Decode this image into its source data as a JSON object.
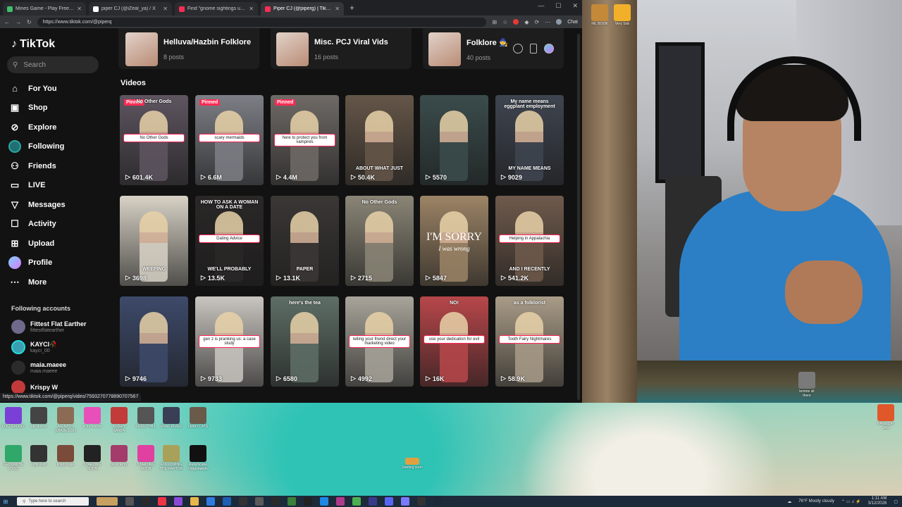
{
  "browser": {
    "tabs": [
      {
        "title": "Mines Game - Play Free Social Ca",
        "color": "#3fbf6a",
        "active": false
      },
      {
        "title": "piper CJ (@iZeal_ya) / X",
        "color": "#ffffff",
        "active": false
      },
      {
        "title": "Find \"gnome sightings utah\" on Ti",
        "color": "#fe2c55",
        "active": false
      },
      {
        "title": "Piper CJ (@piperg) | TikTok",
        "color": "#fe2c55",
        "active": true
      }
    ],
    "url": "https://www.tiktok.com/@piperq",
    "chat_label": "Chat",
    "status_url": "https://www.tiktok.com/@piperq/video/7593270778890707567"
  },
  "sidebar": {
    "logo": "TikTok",
    "search_placeholder": "Search",
    "nav": [
      {
        "label": "For You",
        "icon": "home-icon"
      },
      {
        "label": "Shop",
        "icon": "shopping-bag-icon"
      },
      {
        "label": "Explore",
        "icon": "compass-icon"
      },
      {
        "label": "Following",
        "icon": "following-avatar-icon"
      },
      {
        "label": "Friends",
        "icon": "friends-icon"
      },
      {
        "label": "LIVE",
        "icon": "live-icon"
      },
      {
        "label": "Messages",
        "icon": "paper-plane-icon"
      },
      {
        "label": "Activity",
        "icon": "message-box-icon"
      },
      {
        "label": "Upload",
        "icon": "plus-square-icon"
      },
      {
        "label": "Profile",
        "icon": "profile-avatar-icon"
      },
      {
        "label": "More",
        "icon": "more-dots-icon"
      }
    ],
    "following_title": "Following accounts",
    "accounts": [
      {
        "name": "Fittest Flat Earther",
        "handle": "fittestflatearther"
      },
      {
        "name": "KAYCI🥀",
        "handle": "kayci_00"
      },
      {
        "name": "maia.maeee",
        "handle": "maia.maeee"
      },
      {
        "name": "Krispy W",
        "handle": ""
      }
    ]
  },
  "playlists": [
    {
      "name": "Helluva/Hazbin Folklore",
      "count": "8 posts"
    },
    {
      "name": "Misc. PCJ Viral Vids",
      "count": "16 posts"
    },
    {
      "name": "Folklore 🧙",
      "count": "40 posts"
    }
  ],
  "section_label": "Videos",
  "videos": [
    {
      "views": "601.4K",
      "pinned": "Pinned",
      "caption": "No Other Gods",
      "top_text": "No Other Gods",
      "bottom_text": "",
      "bg": "#5e5560"
    },
    {
      "views": "6.6M",
      "pinned": "Pinned",
      "caption": "scary mermaids",
      "top_text": "",
      "bottom_text": "",
      "bg": "#7d7f86"
    },
    {
      "views": "4.4M",
      "pinned": "Pinned",
      "caption": "here to protect you from vampires",
      "top_text": "",
      "bottom_text": "",
      "bg": "#6f6a66"
    },
    {
      "views": "50.4K",
      "pinned": "",
      "caption": "",
      "top_text": "",
      "bottom_text": "ABOUT WHAT JUST",
      "bg": "#655648"
    },
    {
      "views": "5570",
      "pinned": "",
      "caption": "",
      "top_text": "",
      "bottom_text": "",
      "bg": "#3b4c4c"
    },
    {
      "views": "9029",
      "pinned": "",
      "caption": "",
      "top_text": "My name means eggplant employment",
      "bottom_text": "MY NAME MEANS",
      "bg": "#3f4550"
    },
    {
      "views": "3698",
      "pinned": "",
      "caption": "",
      "top_text": "",
      "bottom_text": "WEEPING",
      "bg": "#d8d2c6"
    },
    {
      "views": "13.5K",
      "pinned": "",
      "caption": "Dating Advice",
      "top_text": "HOW TO ASK A WOMAN ON A DATE",
      "bottom_text": "WE'LL PROBABLY",
      "bg": "#2a2727"
    },
    {
      "views": "13.1K",
      "pinned": "",
      "caption": "",
      "top_text": "",
      "bottom_text": "PAPER",
      "bg": "#3a3735"
    },
    {
      "views": "2715",
      "pinned": "",
      "caption": "",
      "top_text": "No Other Gods",
      "bottom_text": "",
      "bg": "#8a8576"
    },
    {
      "views": "5847",
      "pinned": "",
      "caption": "",
      "top_text": "",
      "bottom_text": "",
      "bg": "#9c8466",
      "big": "I'M SORRY",
      "big_sub": "I was wrong"
    },
    {
      "views": "541.2K",
      "pinned": "",
      "caption": "Helping in Appalachia",
      "top_text": "",
      "bottom_text": "AND I RECENTLY",
      "bg": "#6f5a4c"
    },
    {
      "views": "9746",
      "pinned": "",
      "caption": "",
      "top_text": "",
      "bottom_text": "",
      "bg": "#3d4a6a"
    },
    {
      "views": "9733",
      "pinned": "",
      "caption": "gen z is pranking us: a case study",
      "top_text": "",
      "bottom_text": "",
      "bg": "#c9c5c0"
    },
    {
      "views": "6580",
      "pinned": "",
      "caption": "",
      "top_text": "here's the tea",
      "bottom_text": "",
      "bg": "#5e6e66"
    },
    {
      "views": "4992",
      "pinned": "",
      "caption": "telling your friend direct your marketing video",
      "top_text": "",
      "bottom_text": "",
      "bg": "#a8a49a"
    },
    {
      "views": "16K",
      "pinned": "",
      "caption": "use your dedication for evil",
      "top_text": "NO!",
      "bottom_text": "",
      "bg": "#b7474a"
    },
    {
      "views": "58.9K",
      "pinned": "",
      "caption": "Tooth Fairy Nightmares",
      "top_text": "as a folklorist",
      "bottom_text": "",
      "bg": "#a99c88"
    }
  ],
  "desktop_icons": [
    {
      "label": "DOG GALAXY",
      "color": "#7a3fd6"
    },
    {
      "label": "tab dance",
      "color": "#444"
    },
    {
      "label": "ME WITH SHADES ON",
      "color": "#8c6b54"
    },
    {
      "label": "w for sticker",
      "color": "#e84fb9"
    },
    {
      "label": "KRISPY SANTA",
      "color": "#c23a3a"
    },
    {
      "label": "SILENT HILL",
      "color": "#555"
    },
    {
      "label": "FNAF DIVER",
      "color": "#3a3f55"
    },
    {
      "label": "LMAO CATS",
      "color": "#6a5a4a"
    },
    {
      "label": "GEOCACHE LOGO",
      "color": "#2fa86a"
    },
    {
      "label": "ezgif-2af6",
      "color": "#333"
    },
    {
      "label": "krispy rage",
      "color": "#7a4a3a"
    },
    {
      "label": "STARTING SOON",
      "color": "#222"
    },
    {
      "label": "goon army",
      "color": "#a33c6a"
    },
    {
      "label": "STARTING SOON",
      "color": "#e040a0"
    },
    {
      "label": "FOLLOWING THE RAPTOR",
      "color": "#a9a15a"
    },
    {
      "label": "RuneScape Dragonwilds",
      "color": "#111"
    },
    {
      "label": "IRL BOOK",
      "color": "#c48a3a"
    },
    {
      "label": "Very Sob",
      "color": "#f2b02a"
    },
    {
      "label": "lemme sit there",
      "color": "#7a7a7a"
    },
    {
      "label": "RAVE CAT JAM",
      "color": "#e0582a"
    }
  ],
  "desktop_text": {
    "starting_soon": "Starting soon"
  },
  "taskbar": {
    "search_placeholder": "Type here to search",
    "weather": "76°F Mostly cloudy",
    "time": "1:11 AM",
    "date": "3/12/2026"
  }
}
